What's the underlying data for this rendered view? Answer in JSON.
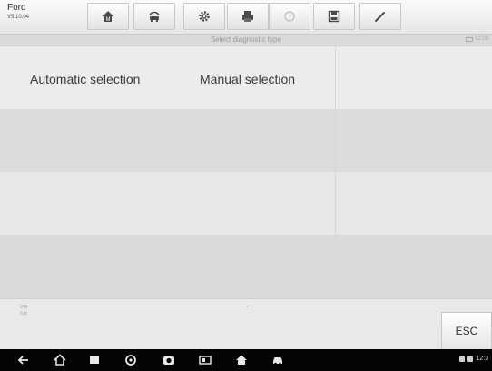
{
  "header": {
    "brand": "Ford",
    "version": "V5.10.04",
    "toolbar": [
      {
        "icon": "home-icon"
      },
      {
        "icon": "vehicle-swap-icon"
      },
      {
        "icon": "gear-icon"
      },
      {
        "icon": "print-icon"
      },
      {
        "icon": "help-icon"
      },
      {
        "icon": "save-icon"
      },
      {
        "icon": "edit-icon"
      }
    ]
  },
  "subheader": {
    "title": "Select diagnostic type",
    "time": "12:09"
  },
  "options": {
    "automatic": "Automatic selection",
    "manual": "Manual selection"
  },
  "footer": {
    "vin_label": "VIN",
    "car_label": "Car",
    "center_mark": "•",
    "esc_label": "ESC"
  },
  "android_nav": {
    "status_time": "12:3"
  }
}
